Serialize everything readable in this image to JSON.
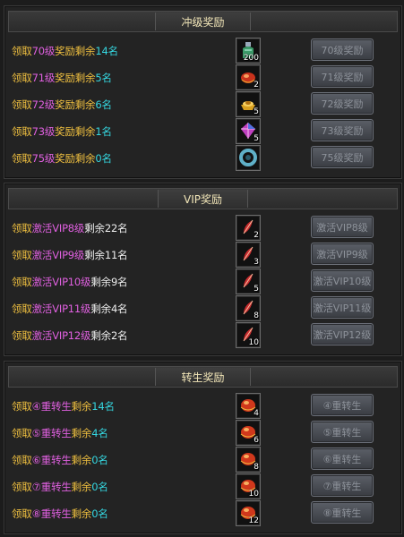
{
  "level_section": {
    "title": "冲级奖励",
    "rows": [
      {
        "pre": "领取",
        "hl": "70级",
        "mid": "奖励剩余",
        "count": "14名",
        "qty": "200",
        "icon": "potion-bottle-icon",
        "button": "70级奖励"
      },
      {
        "pre": "领取",
        "hl": "71级",
        "mid": "奖励剩余",
        "count": "5名",
        "qty": "2",
        "icon": "red-gem-icon",
        "button": "71级奖励"
      },
      {
        "pre": "领取",
        "hl": "72级",
        "mid": "奖励剩余",
        "count": "6名",
        "qty": "5",
        "icon": "gold-ingot-icon",
        "button": "72级奖励"
      },
      {
        "pre": "领取",
        "hl": "73级",
        "mid": "奖励剩余",
        "count": "1名",
        "qty": "5",
        "icon": "crystal-gem-icon",
        "button": "73级奖励"
      },
      {
        "pre": "领取",
        "hl": "75级",
        "mid": "奖励剩余",
        "count": "0名",
        "qty": "",
        "icon": "jade-ring-icon",
        "button": "75级奖励"
      }
    ]
  },
  "vip_section": {
    "title": "VIP奖励",
    "rows": [
      {
        "pre": "领取",
        "hl": "激活VIP8级",
        "mid": "剩余22名",
        "qty": "2",
        "icon": "red-feather-icon",
        "button": "激活VIP8级"
      },
      {
        "pre": "领取",
        "hl": "激活VIP9级",
        "mid": "剩余11名",
        "qty": "3",
        "icon": "red-feather-icon",
        "button": "激活VIP9级"
      },
      {
        "pre": "领取",
        "hl": "激活VIP10级",
        "mid": "剩余9名",
        "qty": "5",
        "icon": "red-feather-icon",
        "button": "激活VIP10级"
      },
      {
        "pre": "领取",
        "hl": "激活VIP11级",
        "mid": "剩余4名",
        "qty": "8",
        "icon": "red-feather-icon",
        "button": "激活VIP11级"
      },
      {
        "pre": "领取",
        "hl": "激活VIP12级",
        "mid": "剩余2名",
        "qty": "10",
        "icon": "red-feather-icon",
        "button": "激活VIP12级"
      }
    ]
  },
  "rebirth_section": {
    "title": "转生奖励",
    "rows": [
      {
        "pre": "领取",
        "hl": "④重转生",
        "mid": "剩余",
        "count": "14名",
        "qty": "4",
        "icon": "red-orb-icon",
        "button": "④重转生"
      },
      {
        "pre": "领取",
        "hl": "⑤重转生",
        "mid": "剩余",
        "count": "4名",
        "qty": "6",
        "icon": "red-orb-icon",
        "button": "⑤重转生"
      },
      {
        "pre": "领取",
        "hl": "⑥重转生",
        "mid": "剩余",
        "count": "0名",
        "qty": "8",
        "icon": "red-orb-icon",
        "button": "⑥重转生"
      },
      {
        "pre": "领取",
        "hl": "⑦重转生",
        "mid": "剩余",
        "count": "0名",
        "qty": "10",
        "icon": "red-orb-icon",
        "button": "⑦重转生"
      },
      {
        "pre": "领取",
        "hl": "⑧重转生",
        "mid": "剩余",
        "count": "0名",
        "qty": "12",
        "icon": "red-orb-icon",
        "button": "⑧重转生"
      }
    ]
  },
  "colors": {
    "accent_yellow": "#f0c040",
    "accent_magenta": "#e060e0",
    "accent_cyan": "#35d7e0",
    "panel_bg": "#232323"
  }
}
